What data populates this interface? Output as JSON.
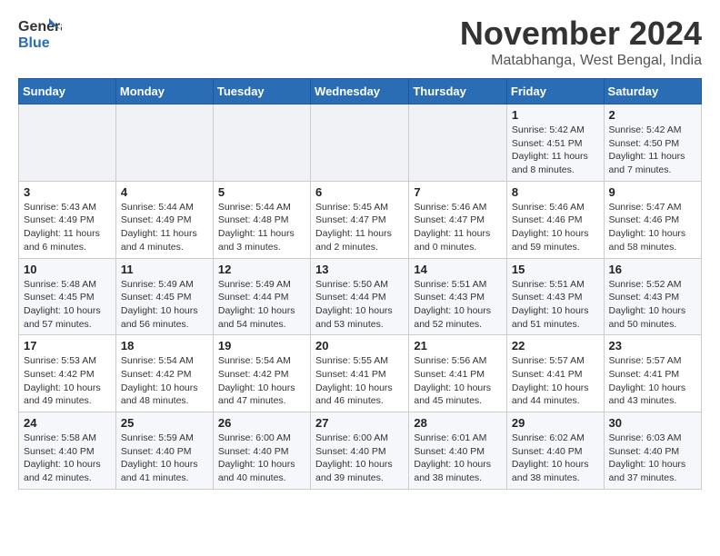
{
  "header": {
    "logo_line1": "General",
    "logo_line2": "Blue",
    "month_year": "November 2024",
    "location": "Matabhanga, West Bengal, India"
  },
  "weekdays": [
    "Sunday",
    "Monday",
    "Tuesday",
    "Wednesday",
    "Thursday",
    "Friday",
    "Saturday"
  ],
  "weeks": [
    [
      {
        "day": "",
        "info": ""
      },
      {
        "day": "",
        "info": ""
      },
      {
        "day": "",
        "info": ""
      },
      {
        "day": "",
        "info": ""
      },
      {
        "day": "",
        "info": ""
      },
      {
        "day": "1",
        "info": "Sunrise: 5:42 AM\nSunset: 4:51 PM\nDaylight: 11 hours\nand 8 minutes."
      },
      {
        "day": "2",
        "info": "Sunrise: 5:42 AM\nSunset: 4:50 PM\nDaylight: 11 hours\nand 7 minutes."
      }
    ],
    [
      {
        "day": "3",
        "info": "Sunrise: 5:43 AM\nSunset: 4:49 PM\nDaylight: 11 hours\nand 6 minutes."
      },
      {
        "day": "4",
        "info": "Sunrise: 5:44 AM\nSunset: 4:49 PM\nDaylight: 11 hours\nand 4 minutes."
      },
      {
        "day": "5",
        "info": "Sunrise: 5:44 AM\nSunset: 4:48 PM\nDaylight: 11 hours\nand 3 minutes."
      },
      {
        "day": "6",
        "info": "Sunrise: 5:45 AM\nSunset: 4:47 PM\nDaylight: 11 hours\nand 2 minutes."
      },
      {
        "day": "7",
        "info": "Sunrise: 5:46 AM\nSunset: 4:47 PM\nDaylight: 11 hours\nand 0 minutes."
      },
      {
        "day": "8",
        "info": "Sunrise: 5:46 AM\nSunset: 4:46 PM\nDaylight: 10 hours\nand 59 minutes."
      },
      {
        "day": "9",
        "info": "Sunrise: 5:47 AM\nSunset: 4:46 PM\nDaylight: 10 hours\nand 58 minutes."
      }
    ],
    [
      {
        "day": "10",
        "info": "Sunrise: 5:48 AM\nSunset: 4:45 PM\nDaylight: 10 hours\nand 57 minutes."
      },
      {
        "day": "11",
        "info": "Sunrise: 5:49 AM\nSunset: 4:45 PM\nDaylight: 10 hours\nand 56 minutes."
      },
      {
        "day": "12",
        "info": "Sunrise: 5:49 AM\nSunset: 4:44 PM\nDaylight: 10 hours\nand 54 minutes."
      },
      {
        "day": "13",
        "info": "Sunrise: 5:50 AM\nSunset: 4:44 PM\nDaylight: 10 hours\nand 53 minutes."
      },
      {
        "day": "14",
        "info": "Sunrise: 5:51 AM\nSunset: 4:43 PM\nDaylight: 10 hours\nand 52 minutes."
      },
      {
        "day": "15",
        "info": "Sunrise: 5:51 AM\nSunset: 4:43 PM\nDaylight: 10 hours\nand 51 minutes."
      },
      {
        "day": "16",
        "info": "Sunrise: 5:52 AM\nSunset: 4:43 PM\nDaylight: 10 hours\nand 50 minutes."
      }
    ],
    [
      {
        "day": "17",
        "info": "Sunrise: 5:53 AM\nSunset: 4:42 PM\nDaylight: 10 hours\nand 49 minutes."
      },
      {
        "day": "18",
        "info": "Sunrise: 5:54 AM\nSunset: 4:42 PM\nDaylight: 10 hours\nand 48 minutes."
      },
      {
        "day": "19",
        "info": "Sunrise: 5:54 AM\nSunset: 4:42 PM\nDaylight: 10 hours\nand 47 minutes."
      },
      {
        "day": "20",
        "info": "Sunrise: 5:55 AM\nSunset: 4:41 PM\nDaylight: 10 hours\nand 46 minutes."
      },
      {
        "day": "21",
        "info": "Sunrise: 5:56 AM\nSunset: 4:41 PM\nDaylight: 10 hours\nand 45 minutes."
      },
      {
        "day": "22",
        "info": "Sunrise: 5:57 AM\nSunset: 4:41 PM\nDaylight: 10 hours\nand 44 minutes."
      },
      {
        "day": "23",
        "info": "Sunrise: 5:57 AM\nSunset: 4:41 PM\nDaylight: 10 hours\nand 43 minutes."
      }
    ],
    [
      {
        "day": "24",
        "info": "Sunrise: 5:58 AM\nSunset: 4:40 PM\nDaylight: 10 hours\nand 42 minutes."
      },
      {
        "day": "25",
        "info": "Sunrise: 5:59 AM\nSunset: 4:40 PM\nDaylight: 10 hours\nand 41 minutes."
      },
      {
        "day": "26",
        "info": "Sunrise: 6:00 AM\nSunset: 4:40 PM\nDaylight: 10 hours\nand 40 minutes."
      },
      {
        "day": "27",
        "info": "Sunrise: 6:00 AM\nSunset: 4:40 PM\nDaylight: 10 hours\nand 39 minutes."
      },
      {
        "day": "28",
        "info": "Sunrise: 6:01 AM\nSunset: 4:40 PM\nDaylight: 10 hours\nand 38 minutes."
      },
      {
        "day": "29",
        "info": "Sunrise: 6:02 AM\nSunset: 4:40 PM\nDaylight: 10 hours\nand 38 minutes."
      },
      {
        "day": "30",
        "info": "Sunrise: 6:03 AM\nSunset: 4:40 PM\nDaylight: 10 hours\nand 37 minutes."
      }
    ]
  ]
}
